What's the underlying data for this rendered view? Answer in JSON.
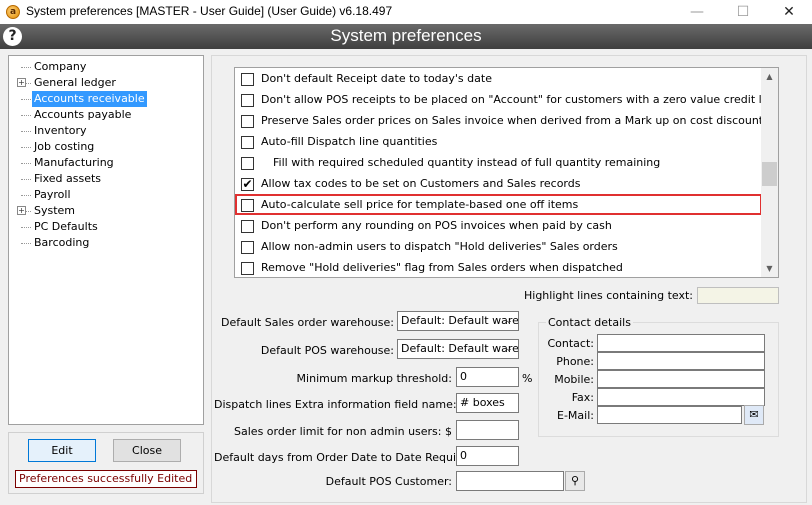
{
  "window": {
    "title": "System preferences [MASTER - User Guide] (User Guide) v6.18.497",
    "header": "System preferences",
    "icon_letter": "a"
  },
  "tree": {
    "items": [
      {
        "label": "Company",
        "expandable": false
      },
      {
        "label": "General ledger",
        "expandable": true
      },
      {
        "label": "Accounts receivable",
        "expandable": false,
        "selected": true
      },
      {
        "label": "Accounts payable",
        "expandable": false
      },
      {
        "label": "Inventory",
        "expandable": false
      },
      {
        "label": "Job costing",
        "expandable": false
      },
      {
        "label": "Manufacturing",
        "expandable": false
      },
      {
        "label": "Fixed assets",
        "expandable": false
      },
      {
        "label": "Payroll",
        "expandable": false
      },
      {
        "label": "System",
        "expandable": true
      },
      {
        "label": "PC Defaults",
        "expandable": false
      },
      {
        "label": "Barcoding",
        "expandable": false
      }
    ]
  },
  "buttons": {
    "edit": "Edit",
    "close": "Close"
  },
  "status": "Preferences successfully Edited",
  "checklist": [
    {
      "label": "Don't default Receipt date to today's date",
      "checked": false
    },
    {
      "label": "Don't allow POS receipts to be placed on \"Account\" for customers with a zero value credit limit",
      "checked": false
    },
    {
      "label": "Preserve Sales order prices on Sales invoice when derived from a Mark up on cost discount",
      "checked": false
    },
    {
      "label": "Auto-fill Dispatch line quantities",
      "checked": false
    },
    {
      "label": "Fill with required scheduled quantity instead of full quantity remaining",
      "checked": false,
      "indent": true
    },
    {
      "label": "Allow tax codes to be set on Customers and Sales records",
      "checked": true
    },
    {
      "label": "Auto-calculate sell price for template-based one off items",
      "checked": false,
      "highlighted": true
    },
    {
      "label": "Don't perform any rounding on POS invoices when paid by cash",
      "checked": false
    },
    {
      "label": "Allow non-admin users to dispatch \"Hold deliveries\" Sales orders",
      "checked": false
    },
    {
      "label": "Remove \"Hold deliveries\" flag from Sales orders when dispatched",
      "checked": false
    }
  ],
  "highlight": {
    "label": "Highlight lines containing text:",
    "value": ""
  },
  "form": {
    "sales_order_warehouse": {
      "label": "Default Sales order warehouse:",
      "value": "Default: Default ware"
    },
    "pos_warehouse": {
      "label": "Default POS warehouse:",
      "value": "Default: Default ware"
    },
    "min_markup": {
      "label": "Minimum markup threshold:",
      "value": "0",
      "suffix": "%"
    },
    "dispatch_extra_field": {
      "label": "Dispatch lines Extra information field name:",
      "value": "# boxes"
    },
    "sales_order_limit": {
      "label": "Sales order limit for non admin users: $",
      "value": ""
    },
    "default_days": {
      "label": "Default days from Order Date to Date Required:",
      "value": "0"
    },
    "pos_customer": {
      "label": "Default POS Customer:",
      "value": ""
    }
  },
  "contact": {
    "legend": "Contact details",
    "fields": [
      {
        "label": "Contact:",
        "value": ""
      },
      {
        "label": "Phone:",
        "value": ""
      },
      {
        "label": "Mobile:",
        "value": ""
      },
      {
        "label": "Fax:",
        "value": ""
      },
      {
        "label": "E-Mail:",
        "value": ""
      }
    ]
  }
}
